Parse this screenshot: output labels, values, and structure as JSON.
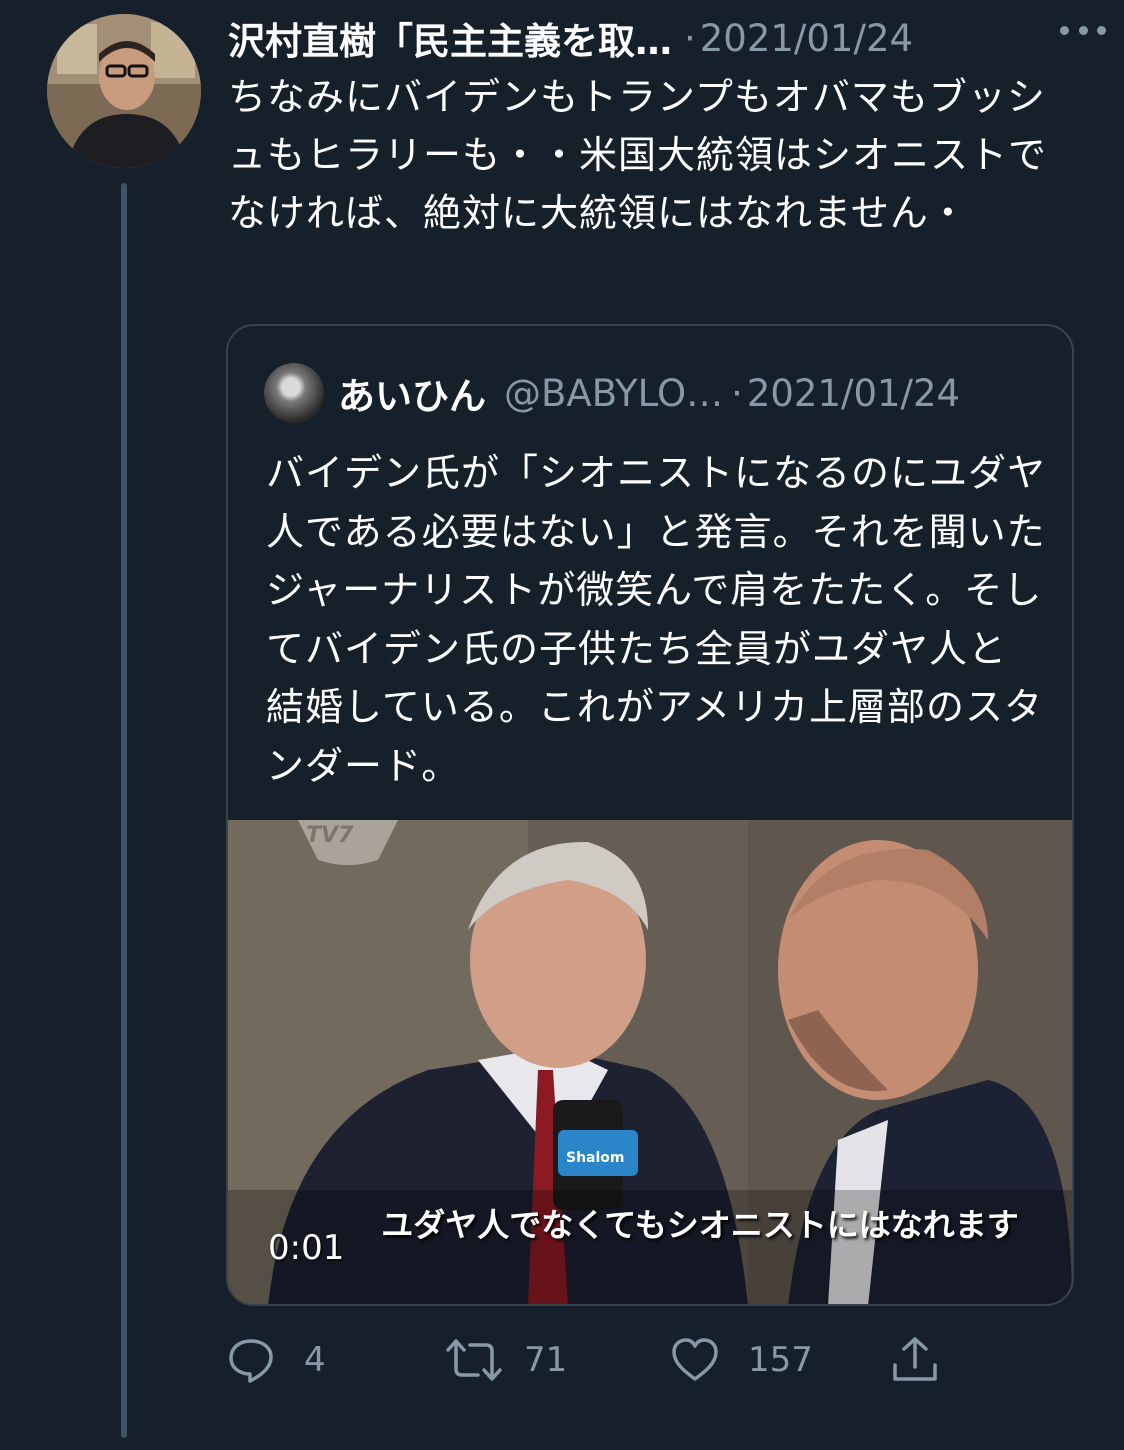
{
  "tweet": {
    "author_name": "沢村直樹「民主主義を取…",
    "separator": "·",
    "date": "2021/01/24",
    "text": "ちなみにバイデンもトランプもオバマもブッシュもヒラリーも・・米国大統領はシオニストでなければ、絶対に大統領にはなれません・",
    "more_icon": "more-horizontal-icon"
  },
  "quote": {
    "name": "あいひん",
    "handle": "@BABYLO…",
    "separator": "·",
    "date": "2021/01/24",
    "text": "バイデン氏が「シオニストになるのにユダヤ人である必要はない」と発言。それを聞いたジャーナリストが微笑んで肩をたたく。そしてバイデン氏の子供たち全員がユダヤ人と結婚している。これがアメリカ上層部のスタンダード。",
    "video": {
      "subtitle": "ユダヤ人でなくてもシオニストにはなれます",
      "timestamp": "0:01",
      "channel_logo": "TV7",
      "mic_label": "Shalom"
    }
  },
  "actions": {
    "reply_count": "4",
    "retweet_count": "71",
    "like_count": "157"
  },
  "colors": {
    "background": "#15202b",
    "secondary_text": "#8899a6",
    "border": "#38444d"
  }
}
